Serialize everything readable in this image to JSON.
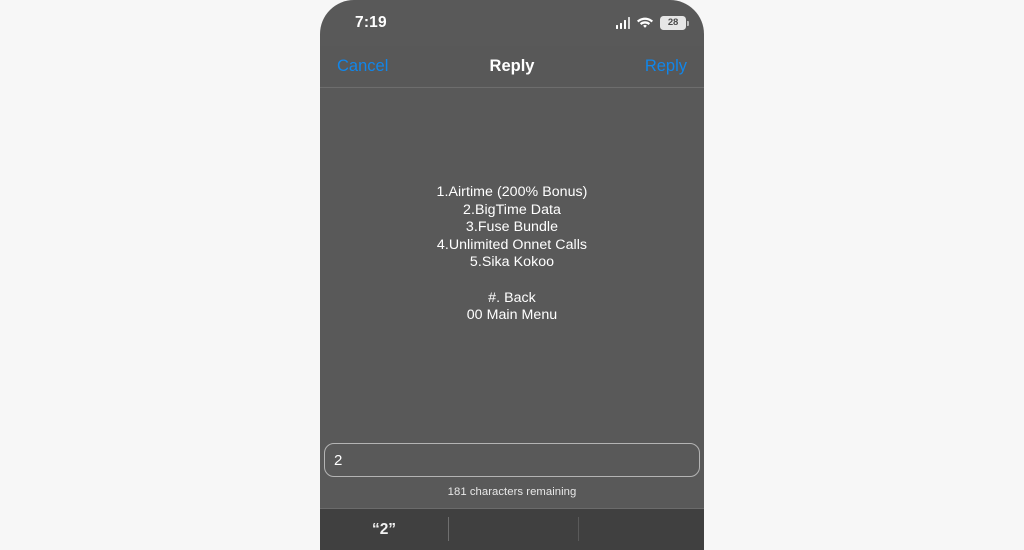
{
  "status_bar": {
    "time": "7:19",
    "signal_icon": "signal-bars-icon",
    "wifi_icon": "wifi-icon",
    "battery_icon": "battery-icon",
    "battery_level": "28"
  },
  "nav_bar": {
    "cancel_label": "Cancel",
    "title": "Reply",
    "reply_label": "Reply"
  },
  "message": {
    "body": "1.Airtime (200% Bonus)\n2.BigTime Data\n3.Fuse Bundle\n4.Unlimited Onnet Calls\n5.Sika Kokoo\n\n#. Back\n00 Main Menu"
  },
  "input": {
    "value": "2",
    "placeholder": "",
    "counter": "181 characters remaining"
  },
  "keyboard": {
    "suggestions": [
      "“2”",
      "",
      ""
    ]
  },
  "colors": {
    "accent_blue": "#1186ea",
    "screen_bg": "#595959",
    "nav_bg": "#585858",
    "keyboard_bg": "#404040",
    "text_primary": "#ffffff",
    "page_bg": "#f7f7f7"
  }
}
